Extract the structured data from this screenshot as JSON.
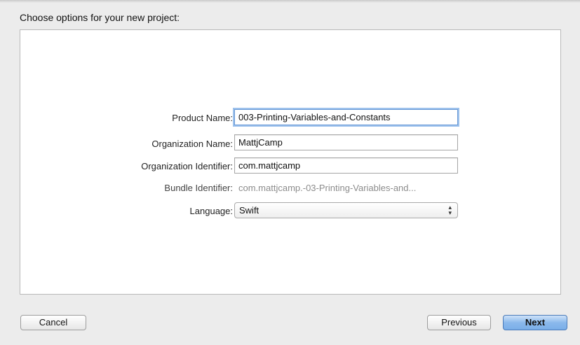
{
  "dialog": {
    "title": "Choose options for your new project:"
  },
  "form": {
    "product_name": {
      "label": "Product Name:",
      "value": "003-Printing-Variables-and-Constants"
    },
    "organization_name": {
      "label": "Organization Name:",
      "value": "MattjCamp"
    },
    "organization_identifier": {
      "label": "Organization Identifier:",
      "value": "com.mattjcamp"
    },
    "bundle_identifier": {
      "label": "Bundle Identifier:",
      "value": "com.mattjcamp.-03-Printing-Variables-and..."
    },
    "language": {
      "label": "Language:",
      "value": "Swift"
    }
  },
  "buttons": {
    "cancel": "Cancel",
    "previous": "Previous",
    "next": "Next"
  },
  "colors": {
    "focus_ring": "#9cc1ec",
    "primary_button": "#8bb9ec"
  }
}
